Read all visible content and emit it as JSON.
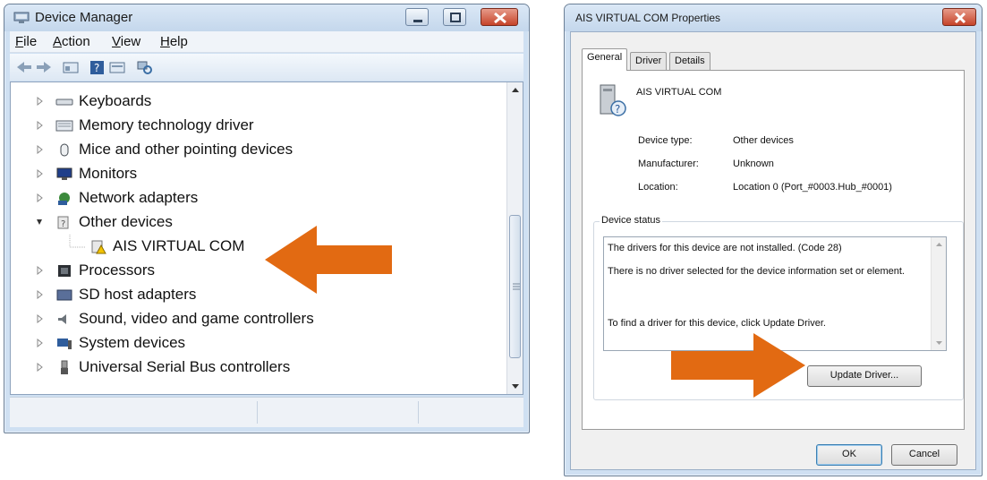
{
  "colors": {
    "arrow": "#e26a12",
    "close_button": "#c6442a",
    "window_frame": "#cfe0f2"
  },
  "device_manager": {
    "title": "Device Manager",
    "menu": [
      {
        "label": "File"
      },
      {
        "label": "Action"
      },
      {
        "label": "View"
      },
      {
        "label": "Help"
      }
    ],
    "tree": [
      {
        "label": "Keyboards",
        "icon": "keyboard-icon",
        "expanded": false
      },
      {
        "label": "Memory technology driver",
        "icon": "memory-icon",
        "expanded": false
      },
      {
        "label": "Mice and other pointing devices",
        "icon": "mouse-icon",
        "expanded": false
      },
      {
        "label": "Monitors",
        "icon": "monitor-icon",
        "expanded": false
      },
      {
        "label": "Network adapters",
        "icon": "network-icon",
        "expanded": false
      },
      {
        "label": "Other devices",
        "icon": "unknown-device-icon",
        "expanded": true
      },
      {
        "label": "AIS VIRTUAL COM",
        "icon": "warning-device-icon",
        "child": true
      },
      {
        "label": "Processors",
        "icon": "processor-icon",
        "expanded": false
      },
      {
        "label": "SD host adapters",
        "icon": "sd-card-icon",
        "expanded": false
      },
      {
        "label": "Sound, video and game controllers",
        "icon": "speaker-icon",
        "expanded": false
      },
      {
        "label": "System devices",
        "icon": "computer-icon",
        "expanded": false
      },
      {
        "label": "Universal Serial Bus controllers",
        "icon": "usb-icon",
        "expanded": false
      }
    ]
  },
  "properties": {
    "title": "AIS VIRTUAL COM Properties",
    "tabs": [
      {
        "label": "General",
        "active": true
      },
      {
        "label": "Driver",
        "active": false
      },
      {
        "label": "Details",
        "active": false
      }
    ],
    "device_name": "AIS VIRTUAL COM",
    "fields": [
      {
        "label": "Device type:",
        "value": "Other devices"
      },
      {
        "label": "Manufacturer:",
        "value": "Unknown"
      },
      {
        "label": "Location:",
        "value": "Location 0 (Port_#0003.Hub_#0001)"
      }
    ],
    "status_group_label": "Device status",
    "status_lines": [
      "The drivers for this device are not installed. (Code 28)",
      "There is no driver selected for the device information set or element.",
      "To find a driver for this device, click Update Driver."
    ],
    "update_driver_label": "Update Driver...",
    "ok_label": "OK",
    "cancel_label": "Cancel"
  }
}
